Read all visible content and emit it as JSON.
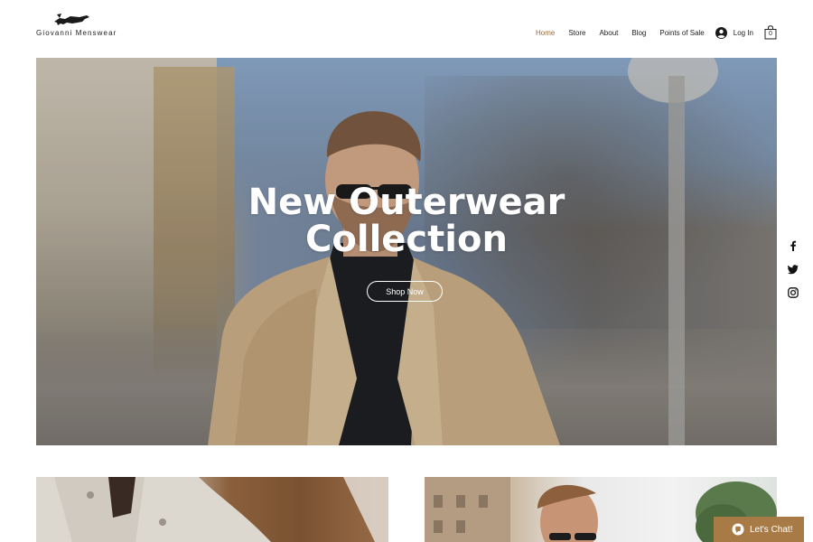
{
  "brand": {
    "name": "Giovanni Menswear",
    "logo_icon": "fox-icon"
  },
  "nav": {
    "items": [
      {
        "label": "Home",
        "active": true
      },
      {
        "label": "Store",
        "active": false
      },
      {
        "label": "About",
        "active": false
      },
      {
        "label": "Blog",
        "active": false
      },
      {
        "label": "Points of Sale",
        "active": false
      }
    ],
    "login_label": "Log In",
    "cart_count": "0"
  },
  "hero": {
    "title_line1": "New Outerwear",
    "title_line2": "Collection",
    "button_label": "Shop Now"
  },
  "social": [
    "facebook-icon",
    "twitter-icon",
    "instagram-icon"
  ],
  "chat": {
    "label": "Let's Chat!"
  },
  "colors": {
    "accent": "#9a6a3a",
    "chat_bg": "#a87b46",
    "text": "#222222"
  }
}
